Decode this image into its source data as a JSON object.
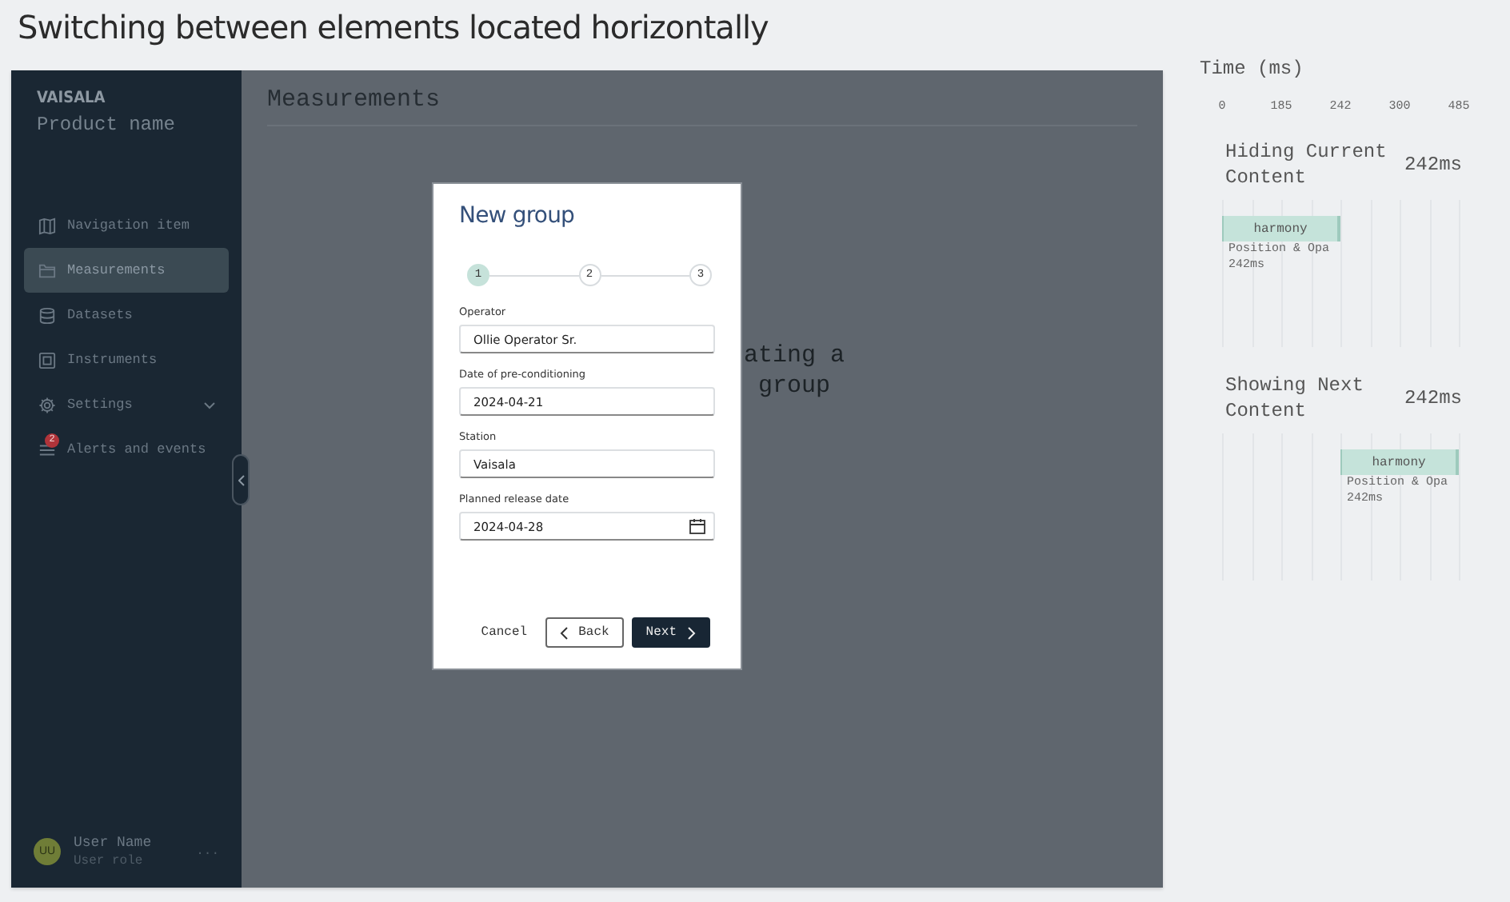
{
  "page_title": "Switching between elements located horizontally",
  "sidebar": {
    "brand": "VAISALA",
    "product": "Product name",
    "items": [
      {
        "label": "Navigation item",
        "selected": false
      },
      {
        "label": "Measurements",
        "selected": true
      },
      {
        "label": "Datasets",
        "selected": false
      },
      {
        "label": "Instruments",
        "selected": false
      },
      {
        "label": "Settings",
        "selected": false,
        "expanded": false
      },
      {
        "label": "Alerts and events",
        "selected": false,
        "badge": "2"
      }
    ],
    "user": {
      "initials": "UU",
      "name": "User Name",
      "role": "User role",
      "more": "..."
    }
  },
  "main": {
    "title": "Measurements",
    "background_text": [
      "ating a",
      "group"
    ]
  },
  "dialog": {
    "title": "New group",
    "steps": [
      {
        "label": "1",
        "selected": true
      },
      {
        "label": "2",
        "selected": false
      },
      {
        "label": "3",
        "selected": false
      }
    ],
    "fields": [
      {
        "label": "Operator",
        "value": "Ollie Operator Sr.",
        "kind": "text"
      },
      {
        "label": "Date of pre-conditioning",
        "value": "2024-04-21",
        "kind": "text"
      },
      {
        "label": "Station",
        "value": "Vaisala",
        "kind": "text"
      },
      {
        "label": "Planned release date",
        "value": "2024-04-28",
        "kind": "date"
      }
    ],
    "buttons": [
      {
        "label": "Cancel",
        "kind": "plain"
      },
      {
        "label": "Back",
        "kind": "back"
      },
      {
        "label": "Next",
        "kind": "next"
      }
    ]
  },
  "timeline": {
    "title": "Time (ms)",
    "ticks": [
      "0",
      "185",
      "242",
      "300",
      "485"
    ],
    "tracks": [
      {
        "name": "Hiding Current Content",
        "duration": "242ms",
        "bar": {
          "label": "harmony",
          "caption": "Position & Opa",
          "time": "242ms"
        }
      },
      {
        "name": "Showing Next Content",
        "duration": "242ms",
        "bar": {
          "label": "harmony",
          "caption": "Position & Opa",
          "time": "242ms"
        }
      }
    ]
  }
}
